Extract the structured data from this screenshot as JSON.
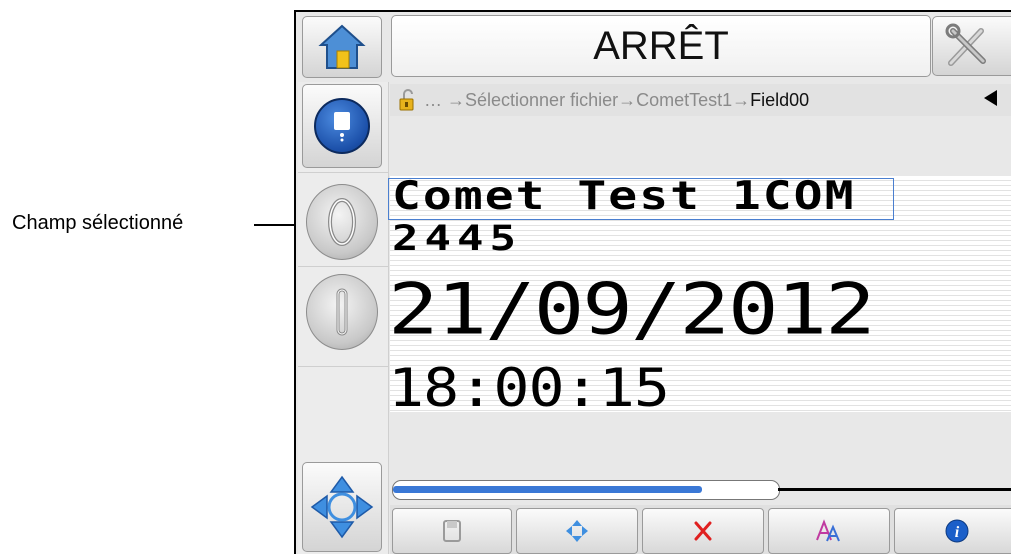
{
  "callout": {
    "label": "Champ sélectionné"
  },
  "header": {
    "status": "ARRÊT"
  },
  "breadcrumb": {
    "lock_icon": "padlock-icon",
    "path": "… →Sélectionner fichier→CometTest1→",
    "current": "Field00"
  },
  "message": {
    "line1": "Comet Test 1COM",
    "line2": "2445",
    "line3": "21/09/2012",
    "line4": "18:00:15"
  },
  "progress": {
    "fraction": 0.8
  },
  "toolbar": {
    "icons": [
      "save-icon",
      "move-icon",
      "delete-icon",
      "text-format-icon",
      "info-icon"
    ]
  },
  "colors": {
    "accent": "#3a78d6",
    "delete": "#e02020",
    "selection": "#4a7fd0"
  }
}
